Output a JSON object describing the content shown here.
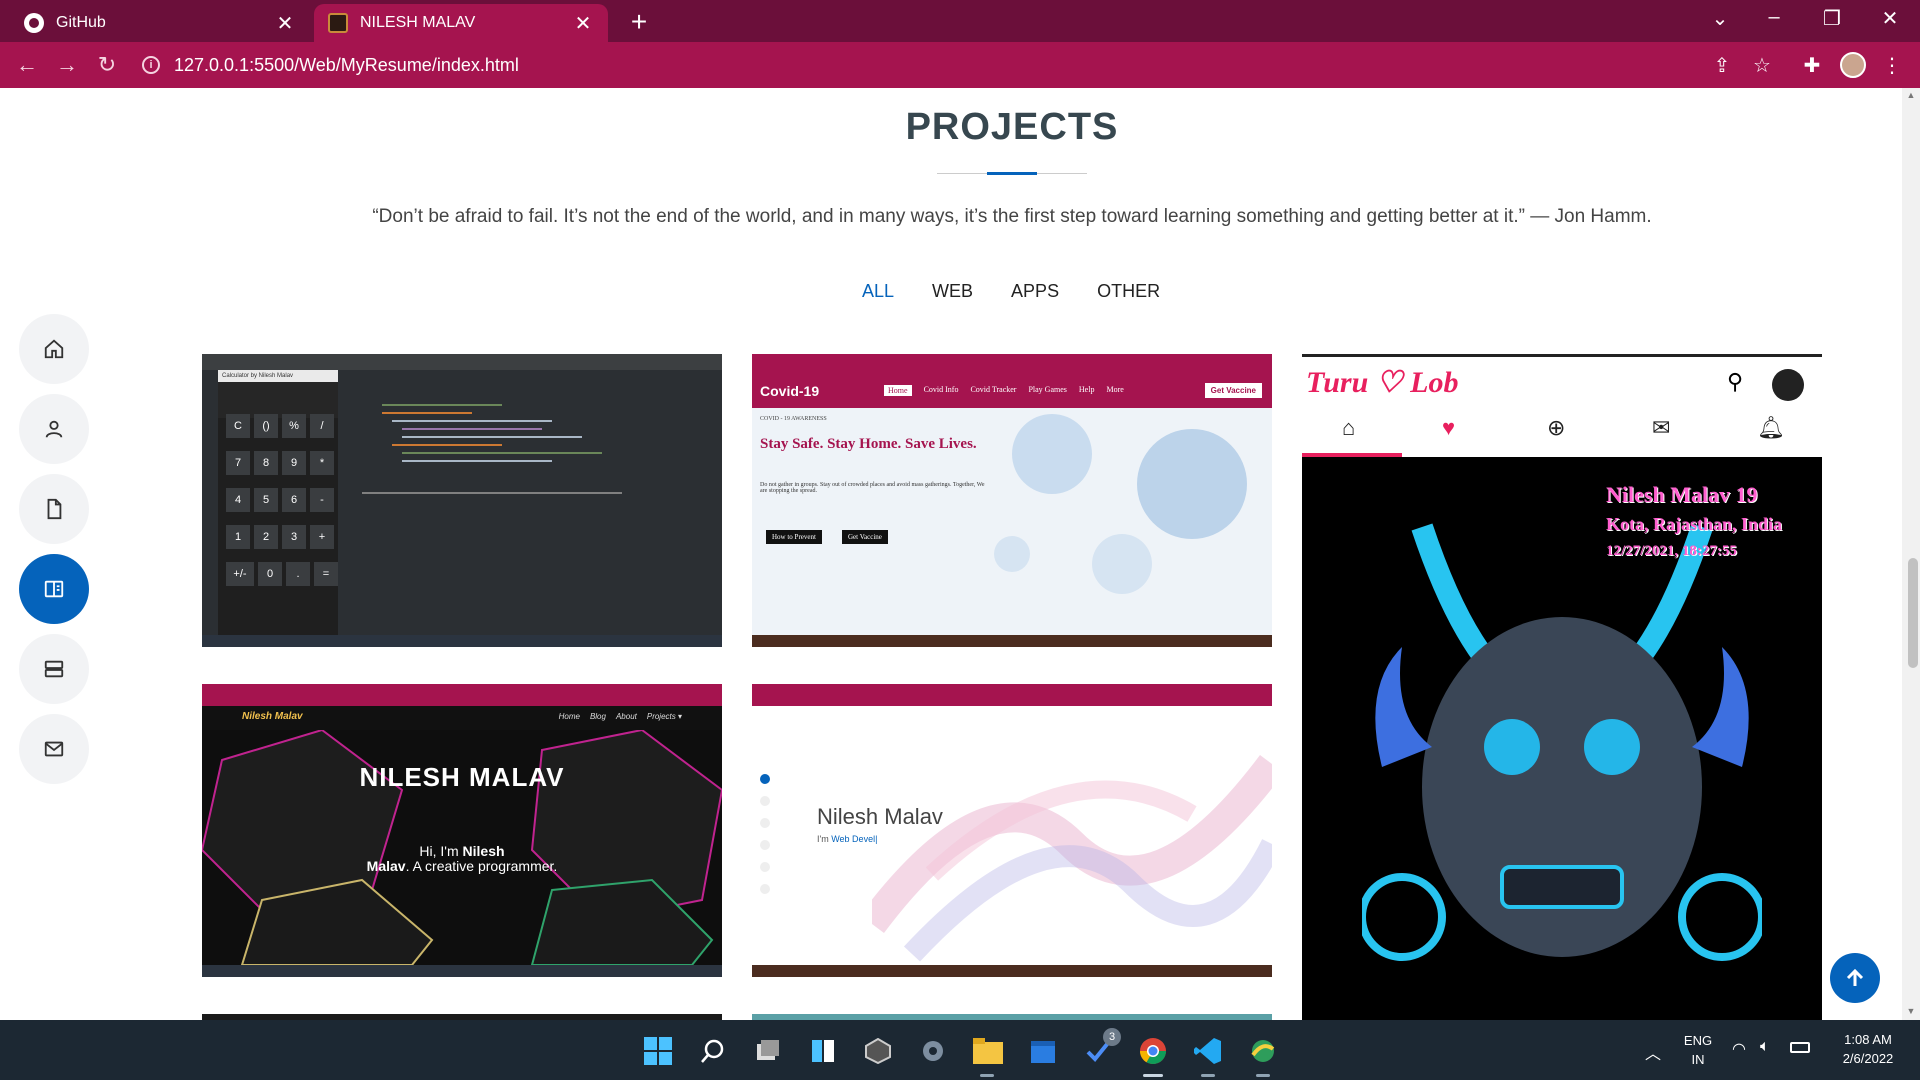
{
  "browser": {
    "tabs": [
      {
        "title": "GitHub",
        "icon": "github-icon",
        "active": false
      },
      {
        "title": "NILESH MALAV",
        "icon": "site-favicon",
        "active": true
      }
    ],
    "url": "127.0.0.1:5500/Web/MyResume/index.html",
    "new_tab_symbol": "+",
    "close_symbol": "✕"
  },
  "page": {
    "title": "PROJECTS",
    "quote": "“Don’t be afraid to fail. It’s not the end of the world, and in many ways, it’s the first step toward learning something and getting better at it.” — Jon Hamm.",
    "filters": [
      {
        "label": "ALL",
        "active": true
      },
      {
        "label": "WEB",
        "active": false
      },
      {
        "label": "APPS",
        "active": false
      },
      {
        "label": "OTHER",
        "active": false
      }
    ],
    "sidenav": [
      {
        "icon": "home-icon",
        "active": false
      },
      {
        "icon": "user-icon",
        "active": false
      },
      {
        "icon": "file-icon",
        "active": false
      },
      {
        "icon": "book-icon",
        "active": true
      },
      {
        "icon": "server-icon",
        "active": false
      },
      {
        "icon": "envelope-icon",
        "active": false
      }
    ],
    "projects": {
      "calculator": {
        "window_title": "Calculator by Nilesh Malav",
        "keys": [
          "C",
          "()",
          "%",
          "/",
          "7",
          "8",
          "9",
          "*",
          "4",
          "5",
          "6",
          "-",
          "1",
          "2",
          "3",
          "+",
          "+/-",
          "0",
          ".",
          "="
        ]
      },
      "covid": {
        "brand": "Covid-19",
        "menu": [
          "Home",
          "Covid Info",
          "Covid Tracker",
          "Play Games",
          "Help",
          "More"
        ],
        "cta": "Get Vaccine",
        "kicker": "COVID - 19 AWARENESS",
        "headline": "Stay Safe. Stay Home. Save Lives.",
        "body": "Do not gather in groups. Stay out of crowded places and avoid mass gatherings. Together, We are stopping the spread.",
        "buttons": [
          "How to Prevent",
          "Get Vaccine"
        ]
      },
      "turu_lob": {
        "logo": "Turu ♡ Lob",
        "overlay_name": "Nilesh Malav 19",
        "overlay_place": "Kota, Rajasthan, India",
        "overlay_time": "12/27/2021, 18:27:55"
      },
      "nilesh_dark": {
        "brand": "Nilesh Malav",
        "menu": [
          "Home",
          "Blog",
          "About",
          "Projects ▾"
        ],
        "title": "NILESH MALAV",
        "sub_prefix": "Hi, I'm ",
        "sub_name_1": "Nilesh",
        "sub_name_2": "Malav",
        "sub_suffix": ". A creative programmer."
      },
      "nilesh_light": {
        "title": "Nilesh Malav",
        "sub_prefix": "I'm ",
        "sub_role": "Web Devel|"
      }
    }
  },
  "taskbar": {
    "lang_1": "ENG",
    "lang_2": "IN",
    "time": "1:08 AM",
    "date": "2/6/2022",
    "badge": "3"
  },
  "colors": {
    "accent": "#0563bb",
    "chrome_dark": "#6b0f3a",
    "chrome": "#a5144f",
    "taskbar": "#1c2833"
  }
}
